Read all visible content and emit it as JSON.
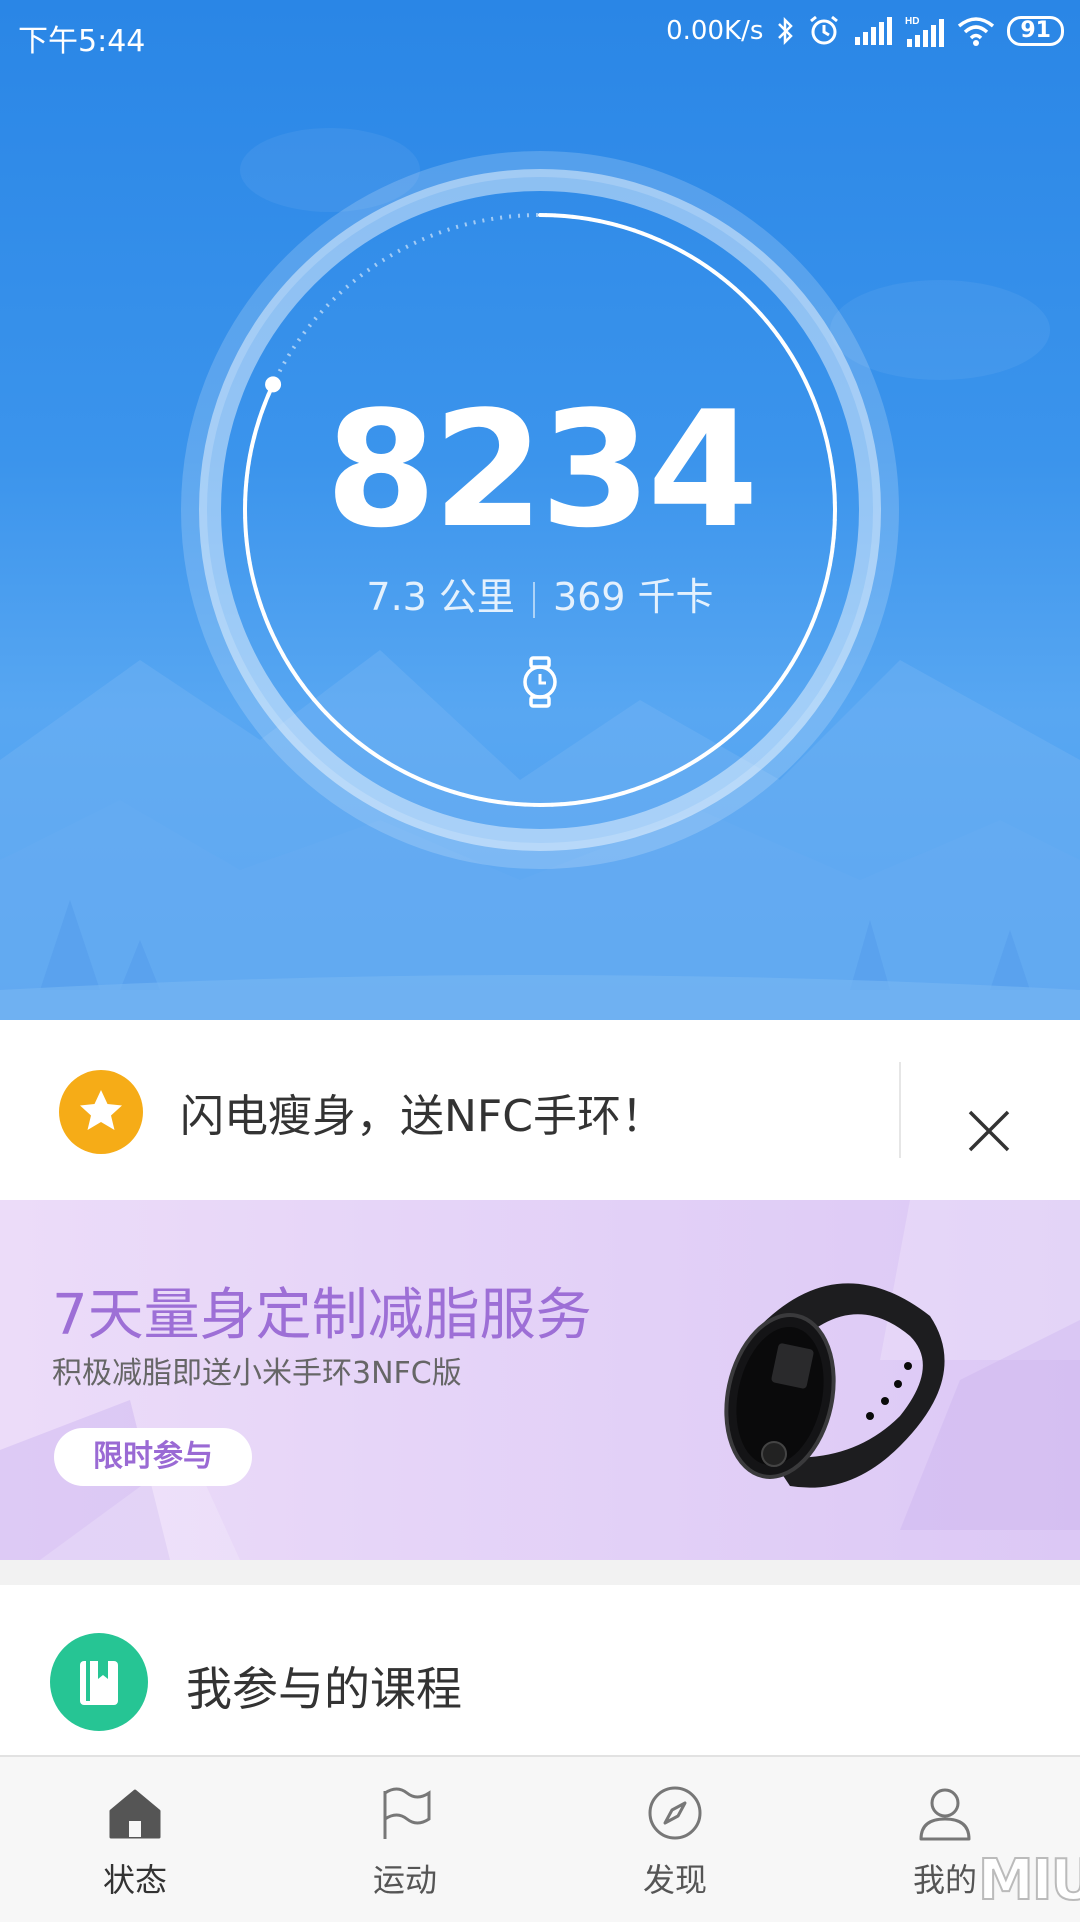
{
  "status_bar": {
    "time": "下午5:44",
    "network_speed": "0.00K/s",
    "battery": "91",
    "icons": [
      "bluetooth-icon",
      "alarm-icon",
      "signal-icon",
      "hd-signal-icon",
      "wifi-icon",
      "battery-icon"
    ]
  },
  "hero": {
    "steps": "8234",
    "distance": "7.3 公里",
    "calories": "369 千卡",
    "goal_progress": 0.82,
    "device_icon": "watch-icon",
    "colors": {
      "sky_top": "#2a86e6",
      "sky_bottom": "#58a7f2"
    }
  },
  "promo": {
    "icon": "star-icon",
    "text": "闪电瘦身，送NFC手环！",
    "close_icon": "close-icon",
    "accent": "#f6ac17"
  },
  "banner": {
    "title": "7天量身定制减脂服务",
    "subtitle": "积极减脂即送小米手环3NFC版",
    "button": "限时参与",
    "image": "fitness-band-image",
    "accent": "#9d6fd6"
  },
  "course": {
    "icon": "book-icon",
    "label": "我参与的课程",
    "accent": "#26c594"
  },
  "tabbar": {
    "items": [
      {
        "label": "状态",
        "icon": "home-icon",
        "active": true
      },
      {
        "label": "运动",
        "icon": "flag-icon",
        "active": false
      },
      {
        "label": "发现",
        "icon": "compass-icon",
        "active": false
      },
      {
        "label": "我的",
        "icon": "user-icon",
        "active": false
      }
    ]
  },
  "watermark": "MIUI"
}
